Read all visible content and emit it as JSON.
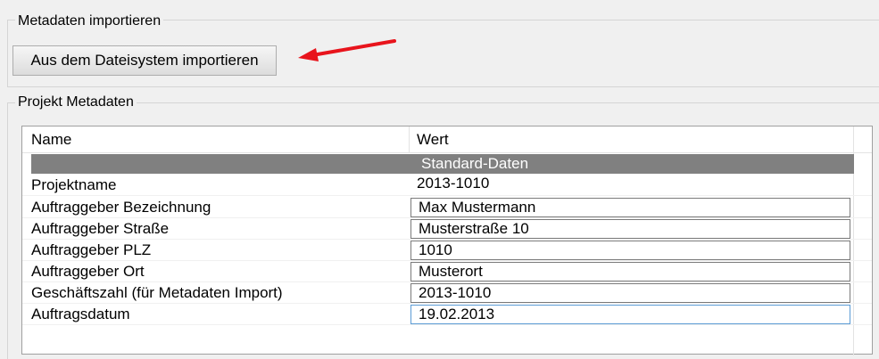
{
  "import_group": {
    "title": "Metadaten importieren",
    "button_label": "Aus dem Dateisystem importieren"
  },
  "metadata_group": {
    "title": "Projekt Metadaten",
    "columns": [
      "Name",
      "Wert"
    ],
    "section_label": "Standard-Daten",
    "rows": [
      {
        "name": "Projektname",
        "value": "2013-1010"
      },
      {
        "name": "Auftraggeber Bezeichnung",
        "value": "Max Mustermann"
      },
      {
        "name": "Auftraggeber Straße",
        "value": "Musterstraße 10"
      },
      {
        "name": "Auftraggeber PLZ",
        "value": "1010"
      },
      {
        "name": "Auftraggeber Ort",
        "value": "Musterort"
      },
      {
        "name": "Geschäftszahl (für Metadaten Import)",
        "value": "2013-1010"
      },
      {
        "name": "Auftragsdatum",
        "value": "19.02.2013"
      }
    ]
  },
  "colors": {
    "annotation_arrow": "#e8141c",
    "section_row": "#808080",
    "focused_input_border": "#5b9bd5"
  },
  "icons": {
    "annotation": "red-arrow-icon"
  }
}
